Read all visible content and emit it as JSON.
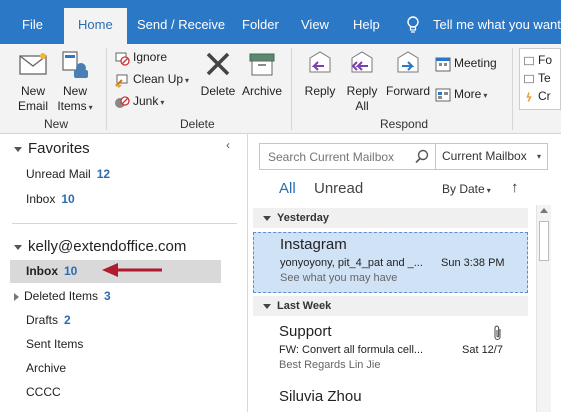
{
  "tabs": [
    "File",
    "Home",
    "Send / Receive",
    "Folder",
    "View",
    "Help"
  ],
  "tell_me": "Tell me what you want t",
  "ribbon": {
    "new_group": {
      "label": "New",
      "new_email": "New\nEmail",
      "new_email_l1": "New",
      "new_email_l2": "Email",
      "new_items_l1": "New",
      "new_items_l2": "Items"
    },
    "delete_group": {
      "label": "Delete",
      "ignore": "Ignore",
      "clean_up": "Clean Up",
      "junk": "Junk",
      "delete": "Delete",
      "archive": "Archive"
    },
    "respond_group": {
      "label": "Respond",
      "reply": "Reply",
      "reply_all_l1": "Reply",
      "reply_all_l2": "All",
      "forward": "Forward",
      "meeting": "Meeting",
      "more": "More"
    },
    "quick_steps": {
      "item1": "Fo",
      "item2": "Te",
      "item3": "Cr"
    }
  },
  "left_pane": {
    "favorites_title": "Favorites",
    "favorites": [
      {
        "name": "Unread Mail",
        "count": "12"
      },
      {
        "name": "Inbox",
        "count": "10"
      }
    ],
    "account": "kelly@extendoffice.com",
    "folders": [
      {
        "name": "Inbox",
        "count": "10"
      },
      {
        "name": "Deleted Items",
        "count": "3"
      },
      {
        "name": "Drafts",
        "count": "2"
      },
      {
        "name": "Sent Items",
        "count": ""
      },
      {
        "name": "Archive",
        "count": ""
      },
      {
        "name": "CCCC",
        "count": ""
      }
    ]
  },
  "search": {
    "placeholder": "Search Current Mailbox",
    "scope": "Current Mailbox"
  },
  "filters": {
    "all": "All",
    "unread": "Unread",
    "sort": "By Date"
  },
  "groups": [
    {
      "title": "Yesterday"
    },
    {
      "title": "Last Week"
    }
  ],
  "messages": [
    {
      "sender": "Instagram",
      "subject": "yonyoyony, pit_4_pat and _...",
      "time": "Sun 3:38 PM",
      "preview": "See what you may have"
    },
    {
      "sender": "Support",
      "subject": "FW: Convert all formula cell...",
      "time": "Sat 12/7",
      "preview": "Best Regards  Lin Jie"
    },
    {
      "sender": "Siluvia Zhou",
      "subject": "",
      "time": "",
      "preview": ""
    }
  ],
  "colors": {
    "accent": "#2b78c7",
    "arrow": "#b01c2e",
    "count": "#2b6cb3"
  }
}
